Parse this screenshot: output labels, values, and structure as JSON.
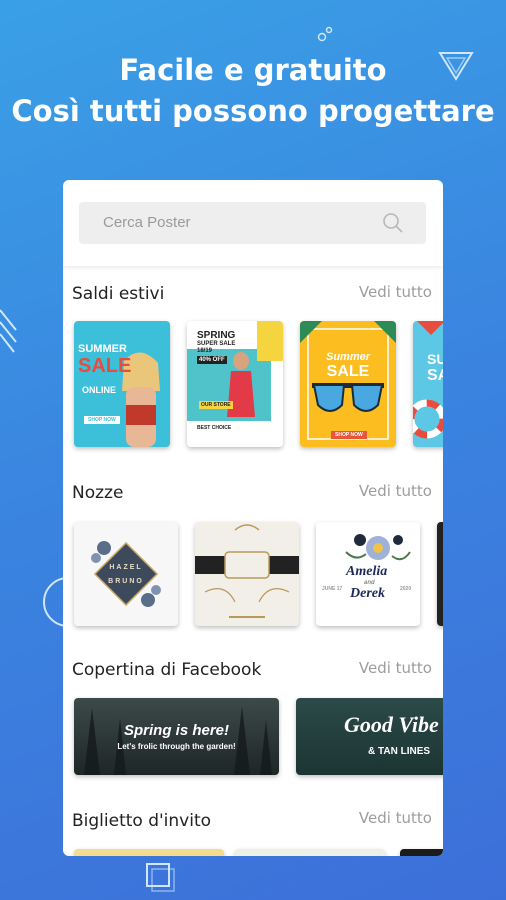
{
  "headline": {
    "line1": "Facile e gratuito",
    "line2": "Così tutti possono progettare"
  },
  "search": {
    "placeholder": "Cerca Poster"
  },
  "sections": [
    {
      "title": "Saldi estivi",
      "see_all": "Vedi tutto"
    },
    {
      "title": "Nozze",
      "see_all": "Vedi tutto"
    },
    {
      "title": "Copertina di Facebook",
      "see_all": "Vedi tutto"
    },
    {
      "title": "Biglietto d'invito",
      "see_all": "Vedi tutto"
    }
  ],
  "templates": {
    "sale1": {
      "l1": "SUMMER",
      "l2": "SALE",
      "l3": "ONLINE",
      "btn": "SHOP NOW"
    },
    "sale2": {
      "l1": "SPRING",
      "l2": "SUPER SALE",
      "l3": "18/19",
      "l4": "40% OFF",
      "l5": "OUR STORE",
      "l6": "BEST CHOICE"
    },
    "sale3": {
      "l1": "Summer",
      "l2": "SALE",
      "btn": "SHOP NOW"
    },
    "sale4": {
      "l1": "SU",
      "l2": "SA"
    },
    "wed1": {
      "l1": "HAZEL",
      "l2": "BRUNO"
    },
    "wed3": {
      "l1": "Amelia",
      "l2": "and",
      "l3": "Derek",
      "l4": "JUNE 17",
      "l5": "2020"
    },
    "fb1": {
      "l1": "Spring is here!",
      "l2": "Let's frolic through the garden!"
    },
    "fb2": {
      "l1": "Good Vibe",
      "l2": "& TAN LINES"
    }
  },
  "colors": {
    "accent": "#3a86e0",
    "card": "#ffffff",
    "search_bg": "#eeeeef"
  }
}
